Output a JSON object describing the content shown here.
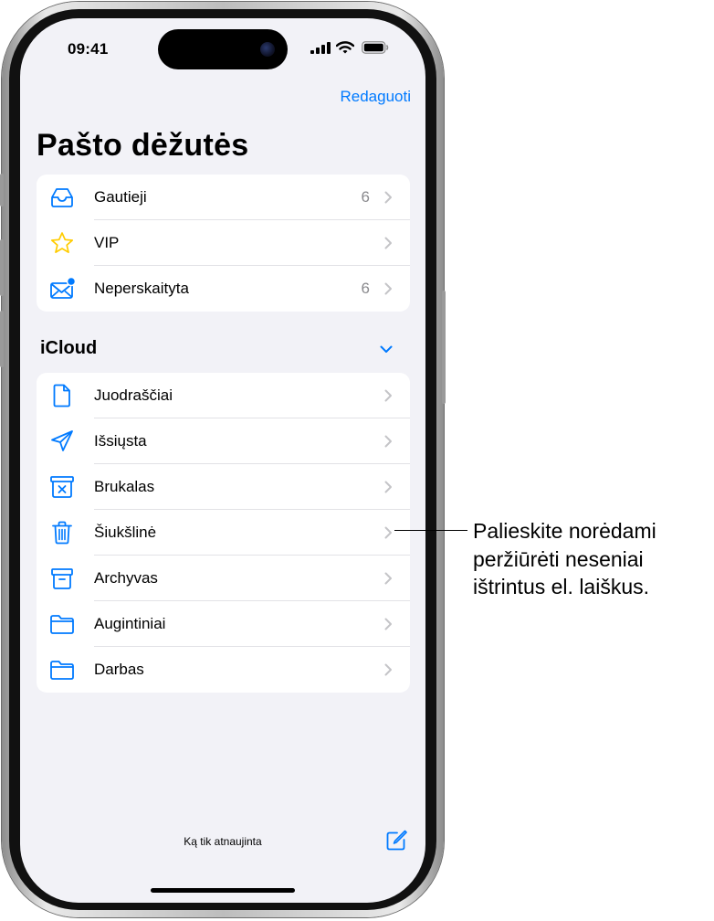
{
  "status_bar": {
    "time": "09:41"
  },
  "header": {
    "edit_label": "Redaguoti",
    "title": "Pašto dėžutės"
  },
  "smart_mailboxes": [
    {
      "label": "Gautieji",
      "count": "6",
      "icon": "inbox-icon"
    },
    {
      "label": "VIP",
      "count": "",
      "icon": "star-icon"
    },
    {
      "label": "Neperskaityta",
      "count": "6",
      "icon": "unread-envelope-icon"
    }
  ],
  "icloud": {
    "title": "iCloud",
    "mailboxes": [
      {
        "label": "Juodraščiai",
        "icon": "document-icon"
      },
      {
        "label": "Išsiųsta",
        "icon": "paperplane-icon"
      },
      {
        "label": "Brukalas",
        "icon": "junk-icon"
      },
      {
        "label": "Šiukšlinė",
        "icon": "trash-icon"
      },
      {
        "label": "Archyvas",
        "icon": "archive-icon"
      },
      {
        "label": "Augintiniai",
        "icon": "folder-icon"
      },
      {
        "label": "Darbas",
        "icon": "folder-icon"
      }
    ]
  },
  "toolbar": {
    "status": "Ką tik atnaujinta"
  },
  "callout": {
    "lines": [
      "Palieskite norėdami",
      "peržiūrėti neseniai",
      "ištrintus el. laiškus."
    ]
  },
  "colors": {
    "accent": "#007aff",
    "background": "#f2f2f7",
    "vip_star": "#ffcc00"
  }
}
